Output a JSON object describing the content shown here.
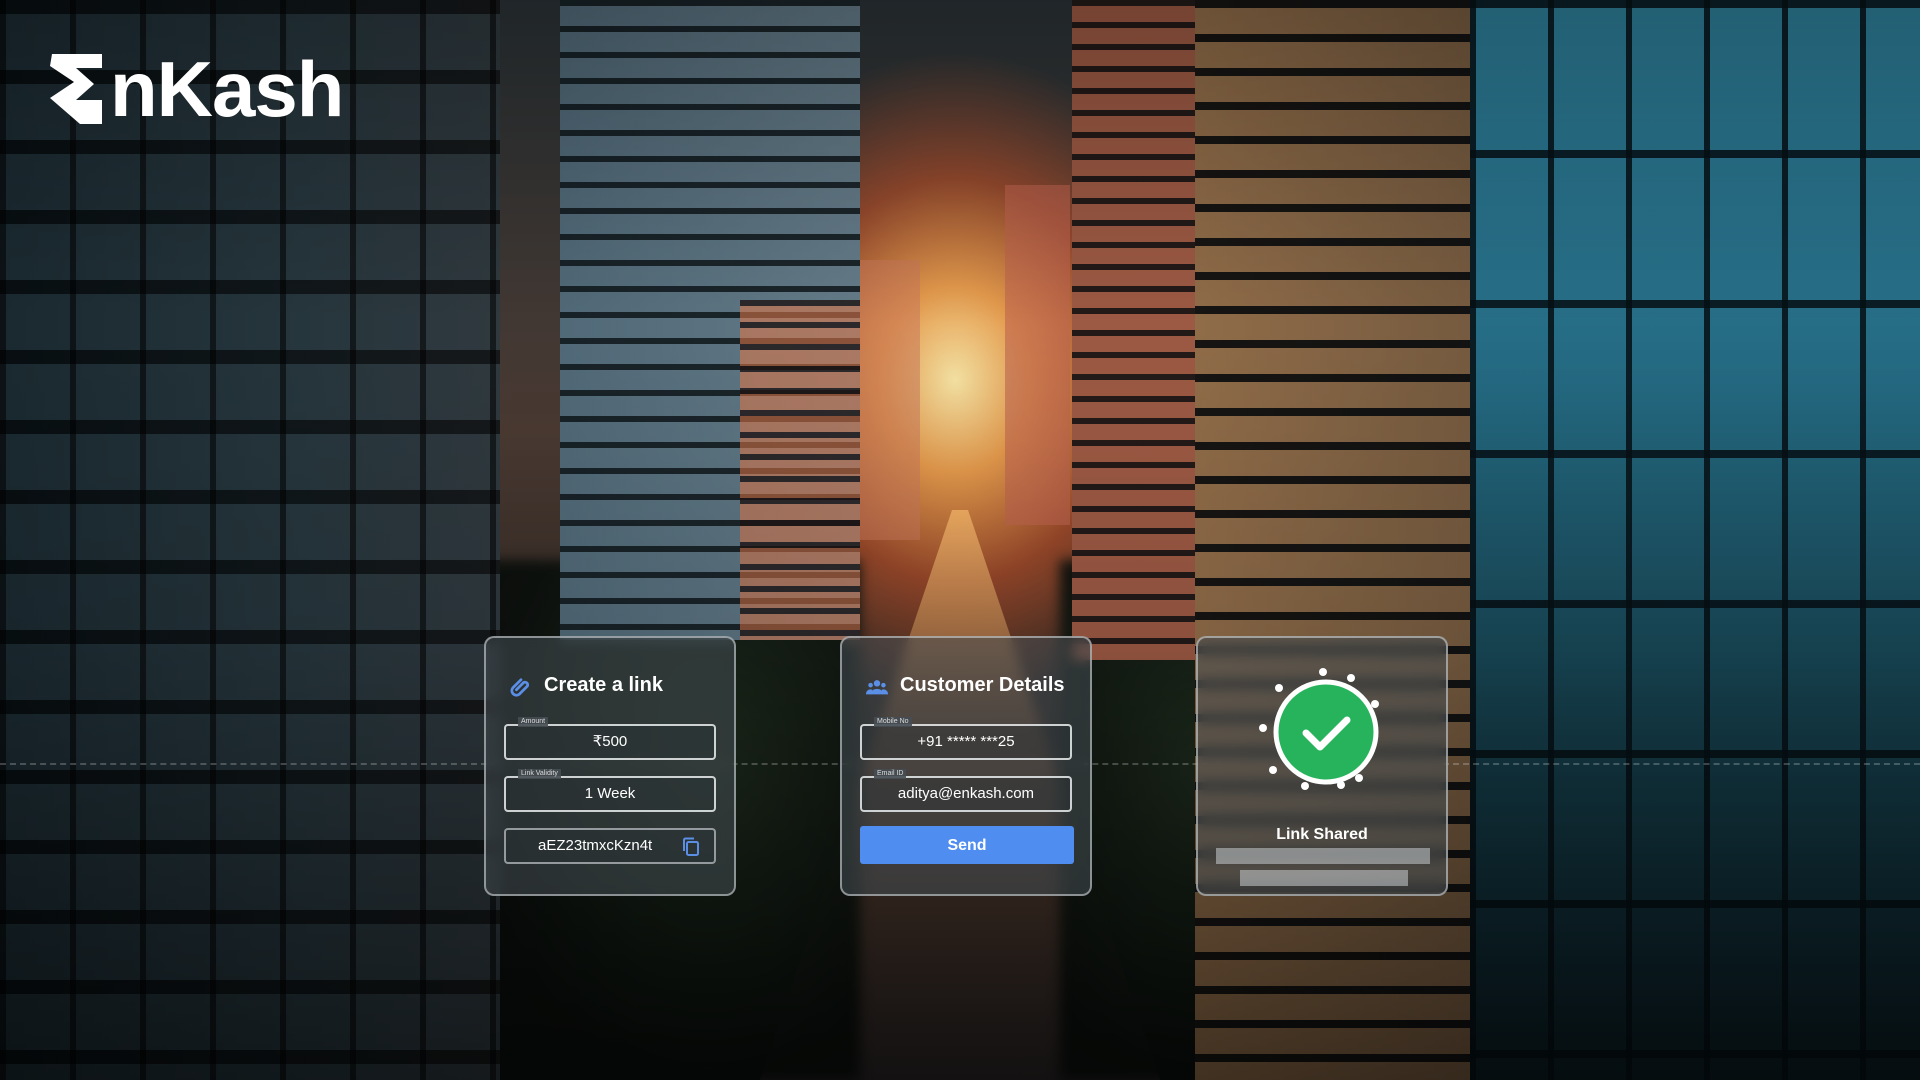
{
  "brand": {
    "logo_text": "nKash",
    "logo_alt_initial": "E"
  },
  "cards": {
    "create_link": {
      "title": "Create a link",
      "icon": "paperclip-icon",
      "amount_label": "Amount",
      "amount_value": "₹500",
      "validity_label": "Link Validity",
      "validity_value": "1 Week",
      "link_code": "aEZ23tmxcKzn4t",
      "copy_icon": "copy-icon"
    },
    "customer_details": {
      "title": "Customer Details",
      "icon": "users-icon",
      "mobile_label": "Mobile No",
      "mobile_value": "+91 ***** ***25",
      "email_label": "Email ID",
      "email_value": "aditya@enkash.com",
      "send_label": "Send",
      "accent": "#4f8ef0"
    },
    "link_shared": {
      "status_label": "Link Shared",
      "icon": "check-circle-icon",
      "success_color": "#27b35c"
    }
  }
}
